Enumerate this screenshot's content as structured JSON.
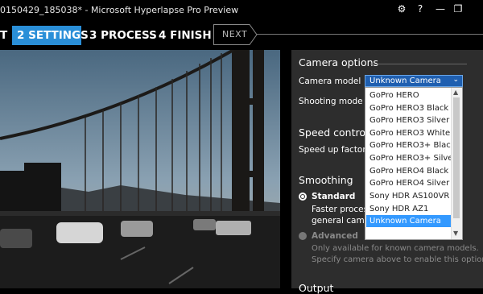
{
  "window": {
    "title": "0150429_185038* - Microsoft Hyperlapse Pro Preview",
    "settings_icon": "⚙",
    "help_icon": "?",
    "minimize_icon": "—",
    "restore_icon": "❐"
  },
  "steps": [
    {
      "label": "T",
      "active": false
    },
    {
      "label": "2 SETTINGS",
      "active": true
    },
    {
      "label": "3 PROCESS",
      "active": false
    },
    {
      "label": "4 FINISH",
      "active": false
    }
  ],
  "next_label": "NEXT",
  "panel": {
    "camera_options": "Camera options",
    "camera_model_label": "Camera model",
    "camera_model_value": "Unknown Camera",
    "shooting_mode_label": "Shooting mode",
    "speed_control": "Speed control",
    "speed_up_factor": "Speed up factor",
    "smoothing": "Smoothing",
    "standard": "Standard",
    "standard_desc_1": "Faster processin",
    "standard_desc_2": "general camera",
    "advanced": "Advanced",
    "advanced_desc_1": "Only available for known camera models.",
    "advanced_desc_2": "Specify camera above to enable this option",
    "output": "Output"
  },
  "dropdown": {
    "options": [
      "GoPro HERO",
      "GoPro HERO3 Black",
      "GoPro HERO3 Silver",
      "GoPro HERO3 White",
      "GoPro HERO3+ Black",
      "GoPro HERO3+ Silver",
      "GoPro HERO4 Black",
      "GoPro HERO4 Silver",
      "Sony HDR AS100VR",
      "Sony HDR AZ1",
      "Unknown Camera"
    ],
    "selected": "Unknown Camera"
  },
  "colors": {
    "accent": "#2a8fd8",
    "panel": "#2d2d2d",
    "selection": "#3399ff"
  }
}
